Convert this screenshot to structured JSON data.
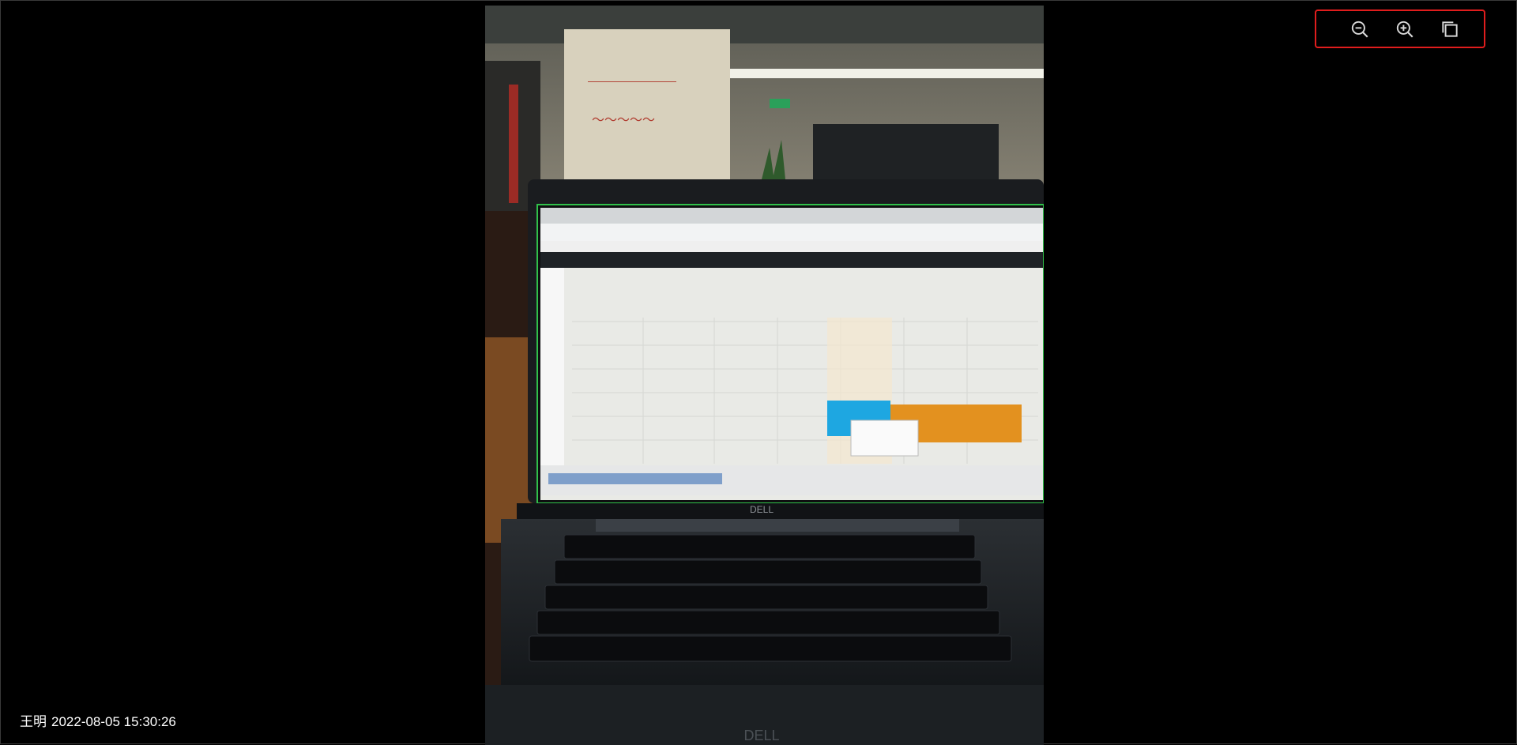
{
  "toolbar": {
    "zoom_out_icon": "zoom-out-icon",
    "zoom_in_icon": "zoom-in-icon",
    "copy_icon": "copy-icon",
    "close_icon": "close-icon"
  },
  "caption": {
    "author": "王明",
    "timestamp": "2022-08-05 15:30:26"
  },
  "photo": {
    "brand": "DELL",
    "laptop_brand": "DELL"
  },
  "colors": {
    "background": "#000000",
    "highlight": "#e01d1d"
  }
}
